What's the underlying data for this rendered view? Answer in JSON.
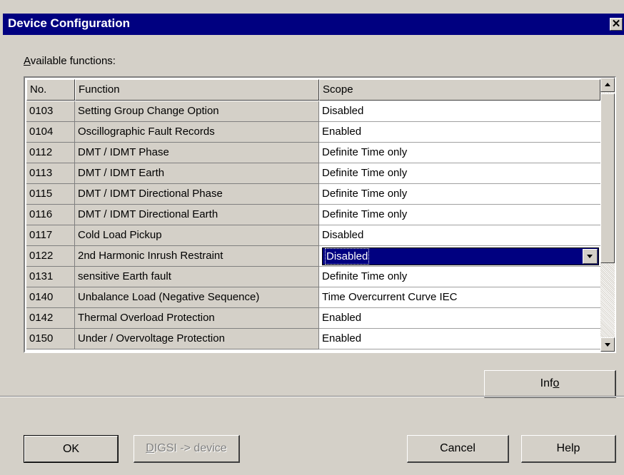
{
  "window": {
    "title": "Device Configuration",
    "close_glyph": "✕"
  },
  "available_label_prefix": "A",
  "available_label_rest": "vailable functions:",
  "table": {
    "headers": [
      "No.",
      "Function",
      "Scope"
    ],
    "rows": [
      {
        "no": "0103",
        "function": "Setting Group Change Option",
        "scope": "Disabled"
      },
      {
        "no": "0104",
        "function": "Oscillographic Fault Records",
        "scope": "Enabled"
      },
      {
        "no": "0112",
        "function": "DMT / IDMT Phase",
        "scope": "Definite Time only"
      },
      {
        "no": "0113",
        "function": "DMT / IDMT Earth",
        "scope": "Definite Time only"
      },
      {
        "no": "0115",
        "function": "DMT / IDMT Directional Phase",
        "scope": "Definite Time only"
      },
      {
        "no": "0116",
        "function": "DMT / IDMT Directional Earth",
        "scope": "Definite Time only"
      },
      {
        "no": "0117",
        "function": "Cold Load Pickup",
        "scope": "Disabled"
      },
      {
        "no": "0122",
        "function": "2nd Harmonic Inrush Restraint",
        "scope": "Disabled"
      },
      {
        "no": "0131",
        "function": "sensitive Earth fault",
        "scope": "Definite Time only"
      },
      {
        "no": "0140",
        "function": "Unbalance Load (Negative Sequence)",
        "scope": "Time Overcurrent Curve IEC"
      },
      {
        "no": "0142",
        "function": "Thermal Overload Protection",
        "scope": "Enabled"
      },
      {
        "no": "0150",
        "function": "Under / Overvoltage Protection",
        "scope": "Enabled"
      }
    ],
    "selected_row": 7
  },
  "buttons": {
    "info": {
      "label_pre": "Inf",
      "label_acc": "o"
    },
    "ok": "OK",
    "digsi": {
      "label_acc": "D",
      "label_rest": "IGSI -> device"
    },
    "cancel": "Cancel",
    "help": "Help"
  },
  "colors": {
    "title_bar": "#000080",
    "selection": "#000080",
    "face": "#d4d0c8"
  }
}
